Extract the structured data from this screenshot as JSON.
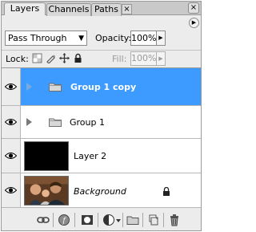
{
  "tabs": [
    {
      "label": "Layers",
      "active": true
    },
    {
      "label": "Channels",
      "active": false
    },
    {
      "label": "Paths",
      "active": false
    }
  ],
  "tab_close_glyph": "×",
  "panel_close_glyph": "×",
  "panel_menu_glyph": "▶",
  "blend_mode": {
    "value": "Pass Through",
    "arrow_glyph": "▼"
  },
  "opacity": {
    "label": "Opacity:",
    "value": "100%",
    "arrow_glyph": "▶"
  },
  "lock": {
    "label": "Lock:",
    "icons": [
      "lock-transparent-icon",
      "lock-image-icon",
      "lock-position-icon",
      "lock-all-icon"
    ]
  },
  "fill": {
    "label": "Fill:",
    "value": "100%",
    "arrow_glyph": "▶"
  },
  "layers": [
    {
      "name": "Group 1 copy",
      "type": "group",
      "visible": true,
      "selected": true,
      "collapsed": true
    },
    {
      "name": "Group 1",
      "type": "group",
      "visible": true,
      "selected": false,
      "collapsed": true
    },
    {
      "name": "Layer 2",
      "type": "layer",
      "visible": true,
      "selected": false,
      "thumbnail": "black-fill"
    },
    {
      "name": "Background",
      "type": "background",
      "visible": true,
      "selected": false,
      "thumbnail": "family-photo",
      "locked": true
    }
  ],
  "toolbar_icons": [
    "link-layers-icon",
    "layer-style-icon",
    "layer-mask-icon",
    "adjustment-layer-icon",
    "new-group-icon",
    "new-layer-icon",
    "trash-icon"
  ],
  "colors": {
    "selection": "#3d9bff",
    "panel_bg": "#ececec"
  }
}
